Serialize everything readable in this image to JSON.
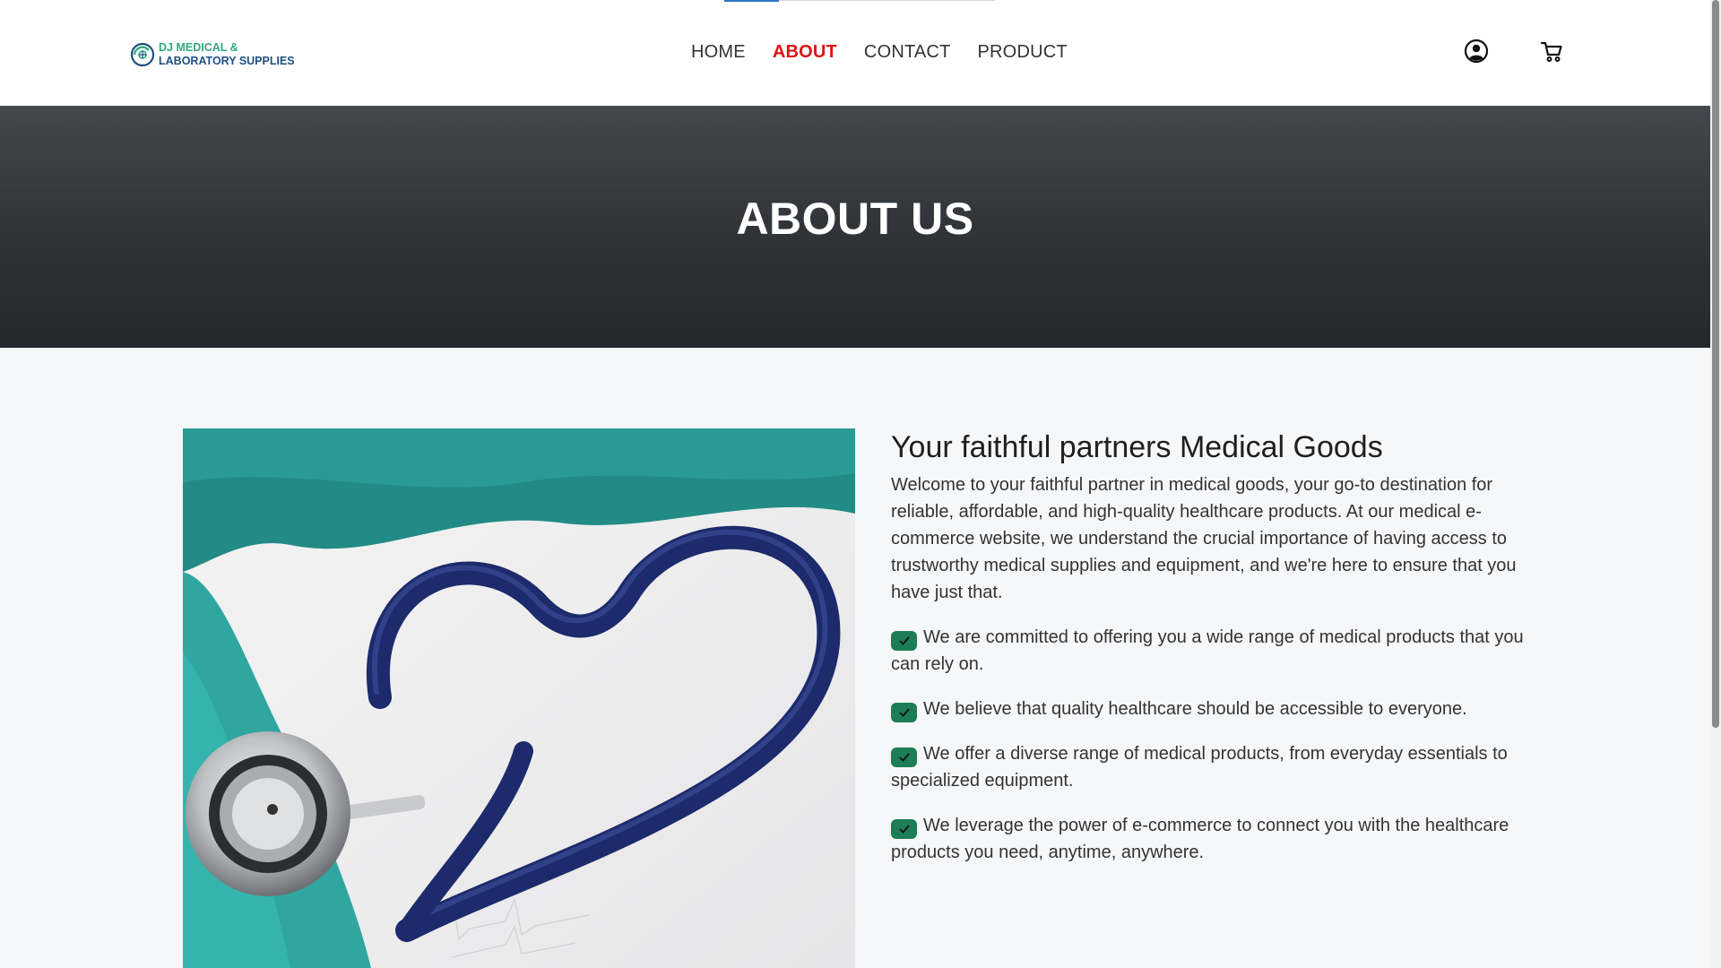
{
  "logo": {
    "line1": "DJ MEDICAL &",
    "line2": "LABORATORY SUPPLIES"
  },
  "nav": {
    "items": [
      "HOME",
      "ABOUT",
      "CONTACT",
      "PRODUCT"
    ],
    "active": "ABOUT"
  },
  "header_icons": [
    "user-account-icon",
    "shopping-cart-icon"
  ],
  "hero": {
    "title": "ABOUT US"
  },
  "about": {
    "heading": "Your faithful partners Medical Goods",
    "intro": "Welcome to your faithful partner in medical goods, your go-to destination for reliable, affordable, and high-quality healthcare products. At our medical e-commerce website, we understand the crucial importance of having access to trustworthy medical supplies and equipment, and we're here to ensure that you have just that.",
    "bullets": [
      "We are committed to offering you a wide range of medical products that you can rely on.",
      "We believe that quality healthcare should be accessible to everyone.",
      "We offer a diverse range of medical products, from everyday essentials to specialized equipment.",
      "We leverage the power of e-commerce to connect you with the healthcare products you need, anytime, anywhere."
    ]
  },
  "colors": {
    "nav_active": "#e01313",
    "check_bg": "#1d7d55",
    "logo_green": "#2fa87f",
    "logo_blue": "#1e4f80"
  }
}
